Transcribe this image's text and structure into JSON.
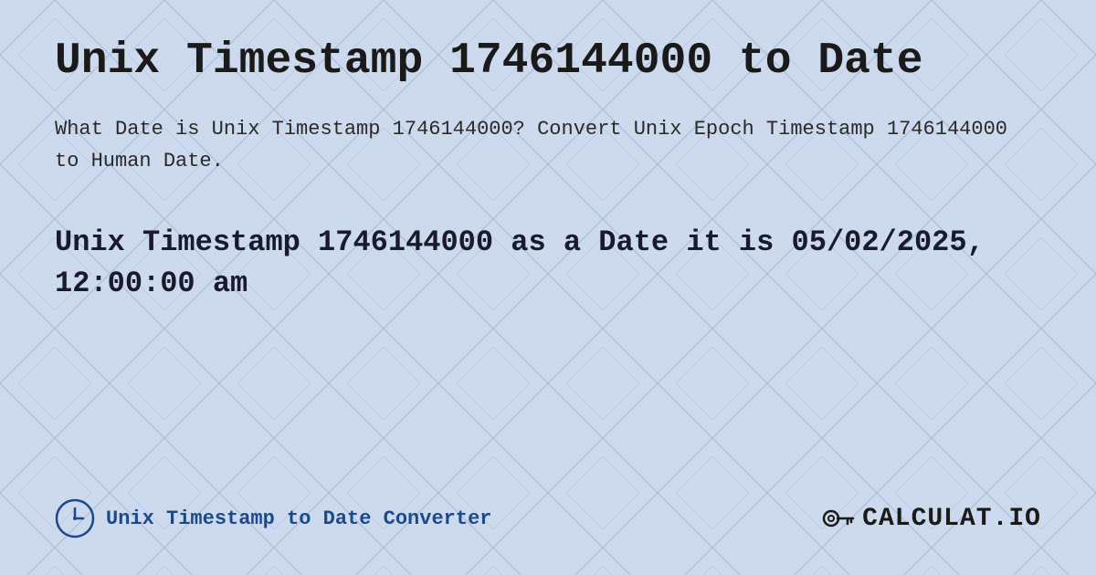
{
  "page": {
    "title": "Unix Timestamp 1746144000 to Date",
    "description": "What Date is Unix Timestamp 1746144000? Convert Unix Epoch Timestamp 1746144000 to Human Date.",
    "result": "Unix Timestamp 1746144000 as a Date it is 05/02/2025, 12:00:00 am",
    "background_color": "#c8d8f0"
  },
  "footer": {
    "label": "Unix Timestamp to Date Converter",
    "logo_text": "CALCULAT.IO"
  }
}
